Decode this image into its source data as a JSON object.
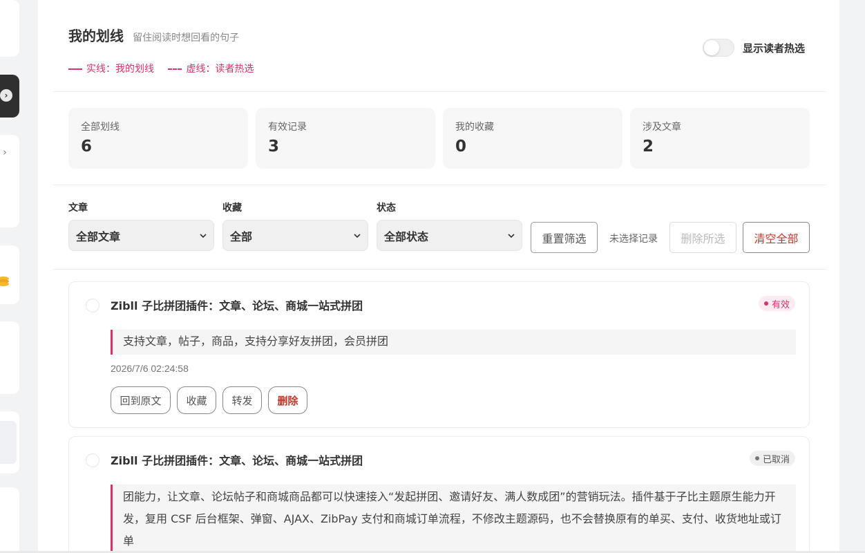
{
  "header": {
    "title": "我的划线",
    "subtitle": "留住阅读时想回看的句子",
    "legend_solid": "实线：我的划线",
    "legend_dashed": "虚线：读者热选",
    "toggle_label": "显示读者热选",
    "toggle_on": false
  },
  "stats": [
    {
      "label": "全部划线",
      "value": "6"
    },
    {
      "label": "有效记录",
      "value": "3"
    },
    {
      "label": "我的收藏",
      "value": "0"
    },
    {
      "label": "涉及文章",
      "value": "2"
    }
  ],
  "filters": {
    "article": {
      "label": "文章",
      "value": "全部文章"
    },
    "favorite": {
      "label": "收藏",
      "value": "全部"
    },
    "status": {
      "label": "状态",
      "value": "全部状态"
    },
    "reset_label": "重置筛选",
    "selection_text": "未选择记录",
    "delete_selected_label": "删除所选",
    "clear_all_label": "清空全部"
  },
  "records": [
    {
      "title": "Zibll 子比拼团插件：文章、论坛、商城一站式拼团",
      "status": "有效",
      "quote": "支持文章，帖子，商品，支持分享好友拼团，会员拼团",
      "time": "2026/7/6 02:24:58",
      "actions": {
        "back": "回到原文",
        "favorite": "收藏",
        "share": "转发",
        "delete": "删除"
      }
    },
    {
      "title": "Zibll 子比拼团插件：文章、论坛、商城一站式拼团",
      "status": "已取消",
      "quote": "团能力，让文章、论坛帖子和商城商品都可以快速接入“发起拼团、邀请好友、满人数成团”的营销玩法。插件基于子比主题原生能力开发，复用 CSF 后台框架、弹窗、AJAX、ZibPay 支付和商城订单流程，不修改主题源码，也不会替换原有的单买、支付、收货地址或订单"
    }
  ],
  "colors": {
    "accent": "#d6336c",
    "danger": "#c0392b",
    "sidebar_dark": "#2f2f2f"
  }
}
